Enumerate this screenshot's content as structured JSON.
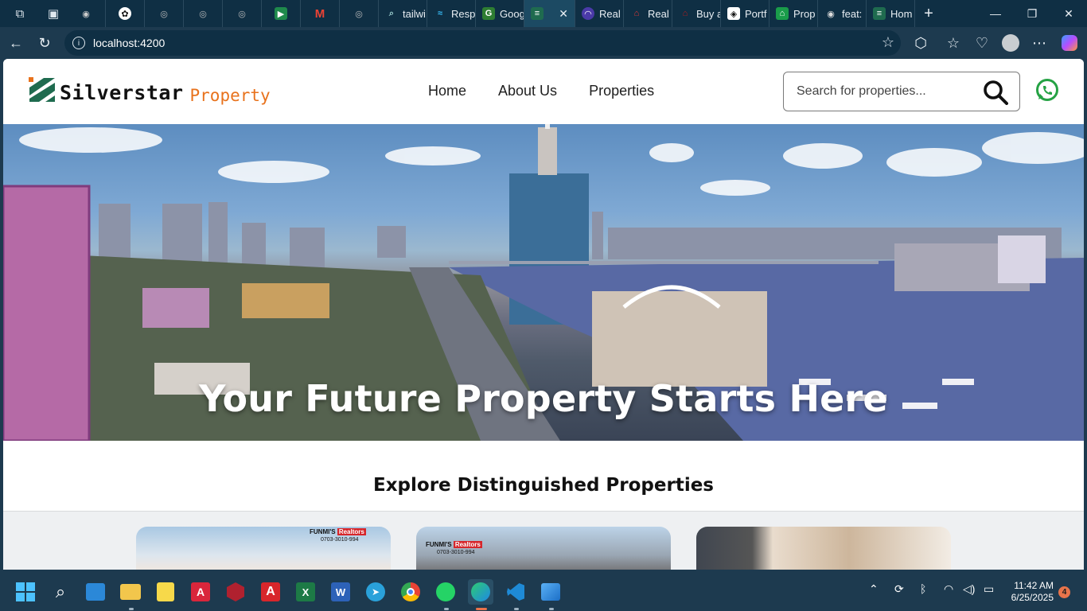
{
  "browser": {
    "tabs": [
      {
        "label": "",
        "icon": "github-icon"
      },
      {
        "label": "",
        "icon": "openai-icon"
      },
      {
        "label": "",
        "icon": "globe-icon"
      },
      {
        "label": "",
        "icon": "globe-icon"
      },
      {
        "label": "",
        "icon": "globe-icon"
      },
      {
        "label": "",
        "icon": "google-meet-icon"
      },
      {
        "label": "",
        "icon": "gmail-icon"
      },
      {
        "label": "",
        "icon": "globe-icon"
      },
      {
        "label": "tailwi",
        "icon": "search-icon"
      },
      {
        "label": "Resp",
        "icon": "tailwind-icon"
      },
      {
        "label": "Goog",
        "icon": "google-icon"
      },
      {
        "label": "",
        "icon": "site-icon"
      },
      {
        "label": "Real",
        "icon": "site-icon"
      },
      {
        "label": "Real",
        "icon": "site-icon"
      },
      {
        "label": "Buy a",
        "icon": "site-icon"
      },
      {
        "label": "Portf",
        "icon": "site-icon"
      },
      {
        "label": "Prop",
        "icon": "home-icon"
      },
      {
        "label": "feat:",
        "icon": "github-icon"
      },
      {
        "label": "Hom",
        "icon": "site-icon"
      }
    ],
    "address": "localhost:4200"
  },
  "site": {
    "logo_word1": "Silverstar",
    "logo_word2": "Property",
    "nav": [
      "Home",
      "About Us",
      "Properties"
    ],
    "search_placeholder": "Search for properties...",
    "hero_title": "Your Future Property Starts Here",
    "section_title": "Explore Distinguished Properties",
    "card_badges": [
      {
        "name": "FUNMI'S",
        "tag": "Realtors",
        "phone": "0703-3010-994"
      },
      {
        "name": "FUNMI'S",
        "tag": "Realtors",
        "phone": "0703-3010-994"
      }
    ]
  },
  "taskbar": {
    "time": "11:42 AM",
    "date": "6/25/2025",
    "notification_count": "4"
  },
  "colors": {
    "brand_orange": "#e8721c",
    "brand_green": "#1f6b4f",
    "whatsapp_green": "#25a244",
    "browser_chrome": "#1d3a4f"
  }
}
